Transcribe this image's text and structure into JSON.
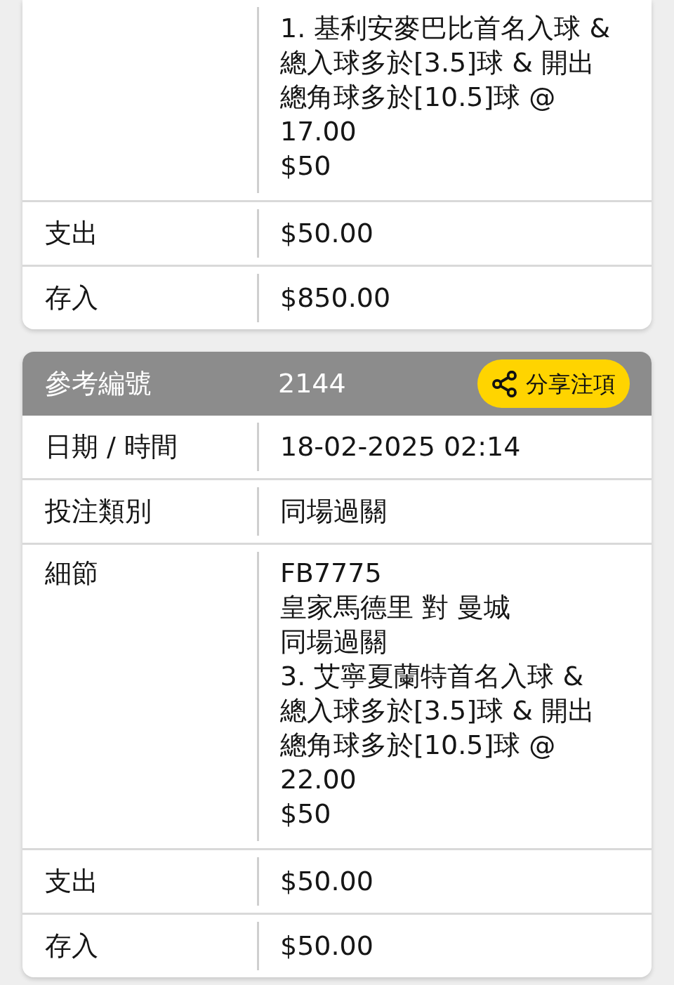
{
  "bets": [
    {
      "rows": [
        {
          "kind": "details",
          "lines": [
            "1. 基利安麥巴比首名入球 & 總入球多於[3.5]球 & 開出總角球多於[10.5]球 @ 17.00",
            "$50"
          ]
        },
        {
          "kind": "field",
          "label": "支出",
          "value": "$50.00"
        },
        {
          "kind": "field",
          "label": "存入",
          "value": "$850.00"
        }
      ]
    },
    {
      "header": {
        "label": "參考編號",
        "value": "2144",
        "share_button": "分享注項"
      },
      "rows": [
        {
          "kind": "field",
          "label": "日期 / 時間",
          "value": "18-02-2025 02:14"
        },
        {
          "kind": "field",
          "label": "投注類別",
          "value": "同場過關"
        },
        {
          "kind": "details",
          "label": "細節",
          "lines": [
            "FB7775",
            "皇家馬德里 對 曼城",
            "同場過關",
            "3. 艾寧夏蘭特首名入球 & 總入球多於[3.5]球 & 開出總角球多於[10.5]球 @ 22.00",
            "$50"
          ]
        },
        {
          "kind": "field",
          "label": "支出",
          "value": "$50.00"
        },
        {
          "kind": "field",
          "label": "存入",
          "value": "$50.00"
        }
      ]
    }
  ]
}
